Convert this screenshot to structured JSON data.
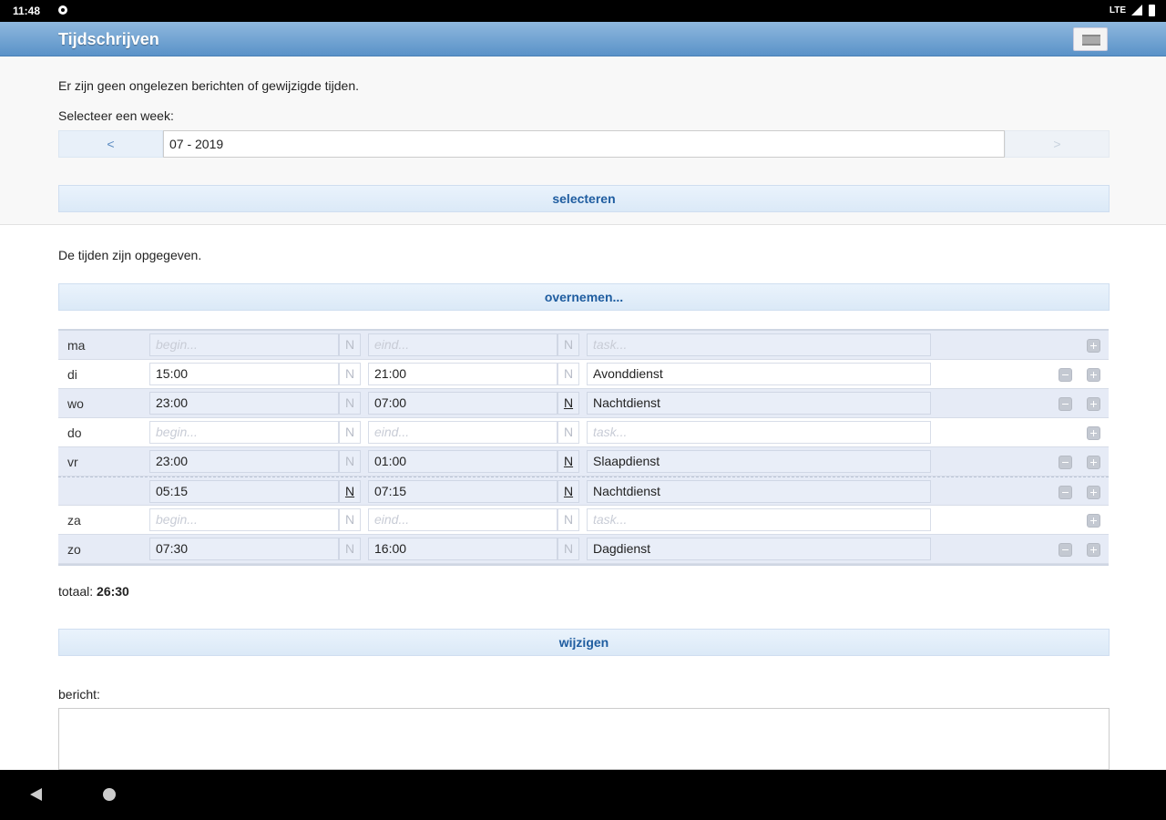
{
  "status": {
    "time": "11:48",
    "network": "LTE"
  },
  "app": {
    "title": "Tijdschrijven"
  },
  "panel": {
    "info": "Er zijn geen ongelezen berichten of gewijzigde tijden.",
    "week_label": "Selecteer een week:",
    "prev": "<",
    "next": ">",
    "week_value": "07 - 2019",
    "select_button": "selecteren"
  },
  "main": {
    "status_text": "De tijden zijn opgegeven.",
    "copy_button": "overnemen...",
    "total_label": "totaal:",
    "total_value": "26:30",
    "edit_button": "wijzigen",
    "message_label": "bericht:"
  },
  "placeholders": {
    "begin": "begin...",
    "end": "eind...",
    "task": "task..."
  },
  "rows": [
    {
      "day": "ma",
      "begin": "",
      "n1": "N",
      "end": "",
      "n2": "N",
      "task": ""
    },
    {
      "day": "di",
      "begin": "15:00",
      "n1": "N",
      "end": "21:00",
      "n2": "N",
      "task": "Avonddienst"
    },
    {
      "day": "wo",
      "begin": "23:00",
      "n1": "N",
      "end": "07:00",
      "n2": "N",
      "task": "Nachtdienst"
    },
    {
      "day": "do",
      "begin": "",
      "n1": "N",
      "end": "",
      "n2": "N",
      "task": ""
    },
    {
      "day": "vr",
      "begin": "23:00",
      "n1": "N",
      "end": "01:00",
      "n2": "N",
      "task": "Slaapdienst"
    },
    {
      "day": "",
      "begin": "05:15",
      "n1": "N",
      "end": "07:15",
      "n2": "N",
      "task": "Nachtdienst"
    },
    {
      "day": "za",
      "begin": "",
      "n1": "N",
      "end": "",
      "n2": "N",
      "task": ""
    },
    {
      "day": "zo",
      "begin": "07:30",
      "n1": "N",
      "end": "16:00",
      "n2": "N",
      "task": "Dagdienst"
    }
  ]
}
